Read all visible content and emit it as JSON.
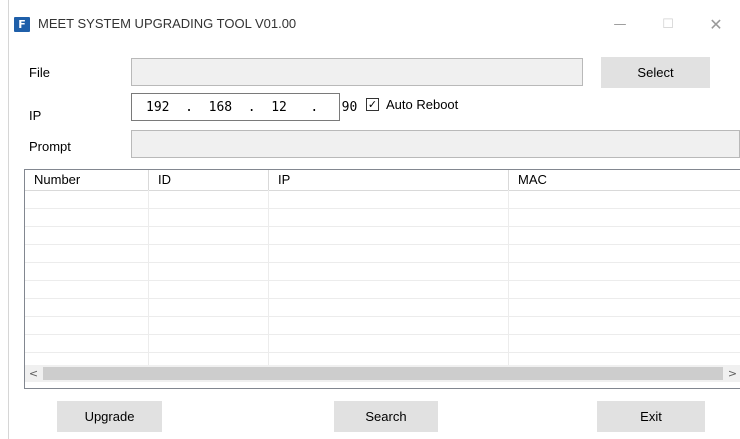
{
  "window": {
    "title": "MEET SYSTEM UPGRADING TOOL V01.00",
    "icon_letter": "F",
    "minimize_glyph": "—",
    "maximize_glyph": "☐",
    "close_glyph": "✕"
  },
  "form": {
    "file_label": "File",
    "file_value": "",
    "select_label": "Select",
    "ip_label": "IP",
    "ip_value": "192  .  168  .  12   .   90",
    "auto_reboot_label": "Auto Reboot",
    "auto_reboot_checked": true,
    "prompt_label": "Prompt",
    "prompt_value": ""
  },
  "table": {
    "columns": [
      "Number",
      "ID",
      "IP",
      "MAC"
    ],
    "rows": []
  },
  "scrollbar": {
    "left_arrow": "<",
    "right_arrow": ">"
  },
  "actions": {
    "upgrade_label": "Upgrade",
    "search_label": "Search",
    "exit_label": "Exit"
  },
  "colors": {
    "accent": "#1f5fa9",
    "button_bg": "#e1e1e1",
    "field_bg": "#f0f0f0"
  }
}
